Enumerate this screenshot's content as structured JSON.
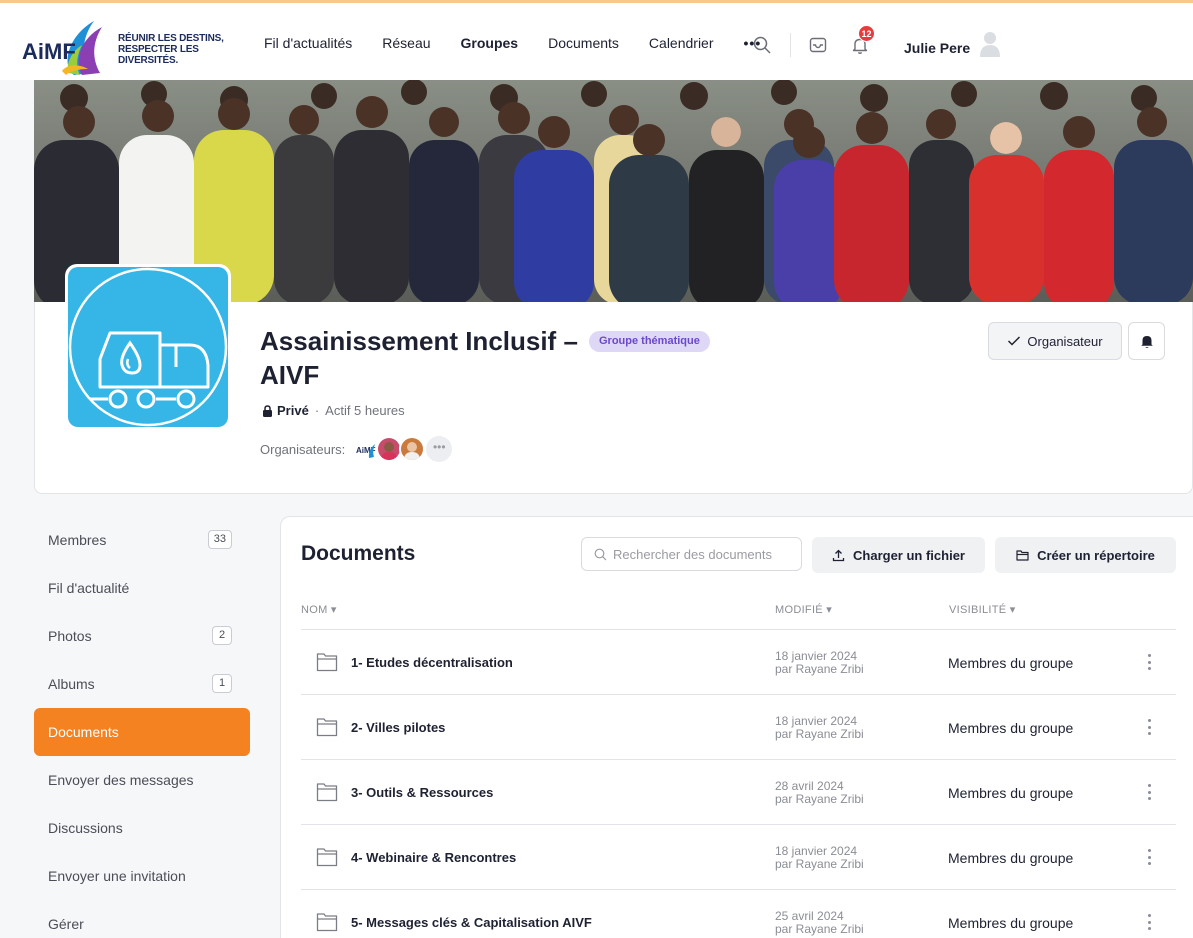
{
  "header": {
    "brand": "AiMF",
    "tagline_line1": "RÉUNIR LES DESTINS,",
    "tagline_line2": "RESPECTER LES DIVERSITÉS.",
    "nav": [
      "Fil d'actualités",
      "Réseau",
      "Groupes",
      "Documents",
      "Calendrier"
    ],
    "active_nav": "Groupes",
    "more": "•••",
    "notification_count": "12",
    "user_name": "Julie Pere",
    "accent_color": "#f48221"
  },
  "group": {
    "title": "Assainissement Inclusif – AIVF",
    "type_badge": "Groupe thématique",
    "privacy": "Privé",
    "activity": "Actif 5 heures",
    "organizers_label": "Organisateurs:",
    "organizers_more": "•••",
    "role_button": "Organisateur",
    "avatar_color": "#35b6e6"
  },
  "sidebar": {
    "items": [
      {
        "label": "Membres",
        "count": "33"
      },
      {
        "label": "Fil d'actualité",
        "count": ""
      },
      {
        "label": "Photos",
        "count": "2"
      },
      {
        "label": "Albums",
        "count": "1"
      },
      {
        "label": "Documents",
        "count": "",
        "active": true
      },
      {
        "label": "Envoyer des messages",
        "count": ""
      },
      {
        "label": "Discussions",
        "count": ""
      },
      {
        "label": "Envoyer une invitation",
        "count": ""
      },
      {
        "label": "Gérer",
        "count": ""
      }
    ]
  },
  "documents": {
    "title": "Documents",
    "search_placeholder": "Rechercher des documents",
    "upload_button": "Charger un fichier",
    "create_folder_button": "Créer un répertoire",
    "columns": {
      "name": "NOM ▾",
      "modified": "MODIFIÉ ▾",
      "visibility": "VISIBILITÉ ▾"
    },
    "rows": [
      {
        "name": "1- Etudes décentralisation",
        "date": "18 janvier 2024",
        "author": "par Rayane Zribi",
        "visibility": "Membres du groupe"
      },
      {
        "name": "2- Villes pilotes",
        "date": "18 janvier 2024",
        "author": "par Rayane Zribi",
        "visibility": "Membres du groupe"
      },
      {
        "name": "3- Outils & Ressources",
        "date": "28 avril 2024",
        "author": "par Rayane Zribi",
        "visibility": "Membres du groupe"
      },
      {
        "name": "4- Webinaire & Rencontres",
        "date": "18 janvier 2024",
        "author": "par Rayane Zribi",
        "visibility": "Membres du groupe"
      },
      {
        "name": "5- Messages clés & Capitalisation AIVF",
        "date": "25 avril 2024",
        "author": "par Rayane Zribi",
        "visibility": "Membres du groupe"
      }
    ]
  }
}
